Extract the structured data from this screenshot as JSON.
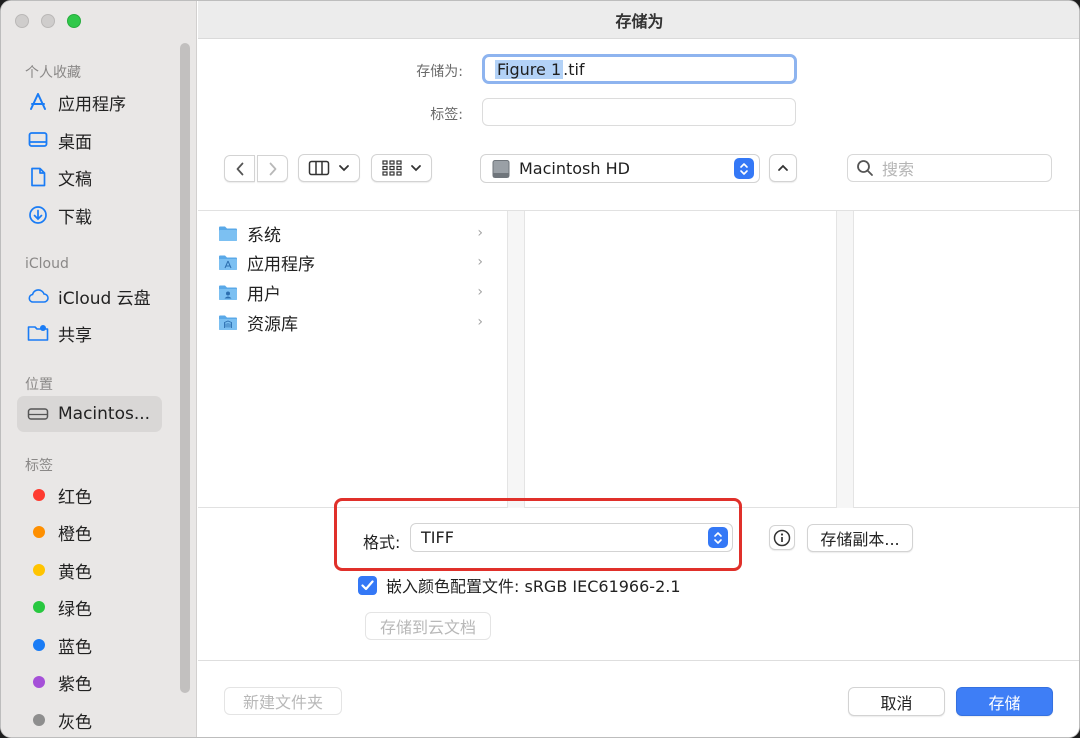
{
  "window": {
    "title": "存储为"
  },
  "sidebar": {
    "favorites_header": "个人收藏",
    "favorites": [
      {
        "label": "应用程序",
        "icon": "apps-icon"
      },
      {
        "label": "桌面",
        "icon": "desktop-icon"
      },
      {
        "label": "文稿",
        "icon": "document-icon"
      },
      {
        "label": "下载",
        "icon": "download-icon"
      }
    ],
    "icloud_header": "iCloud",
    "icloud": [
      {
        "label": "iCloud 云盘",
        "icon": "cloud-icon"
      },
      {
        "label": "共享",
        "icon": "shared-folder-icon"
      }
    ],
    "locations_header": "位置",
    "locations": [
      {
        "label": "Macintos...",
        "icon": "disk-icon",
        "selected": true
      }
    ],
    "tags_header": "标签",
    "tags": [
      {
        "label": "红色",
        "color": "#fe3b30"
      },
      {
        "label": "橙色",
        "color": "#fe8f00"
      },
      {
        "label": "黄色",
        "color": "#ffc400"
      },
      {
        "label": "绿色",
        "color": "#28c840"
      },
      {
        "label": "蓝色",
        "color": "#1a7cf5"
      },
      {
        "label": "紫色",
        "color": "#a550d8"
      },
      {
        "label": "灰色",
        "color": "#8e8e8e"
      }
    ]
  },
  "form": {
    "saveas_label": "存储为:",
    "filename_selected": "Figure 1",
    "filename_ext": ".tif",
    "tags_label": "标签:"
  },
  "toolbar": {
    "location": "Macintosh HD",
    "search_placeholder": "搜索"
  },
  "browser": {
    "items": [
      {
        "label": "系统"
      },
      {
        "label": "应用程序"
      },
      {
        "label": "用户"
      },
      {
        "label": "资源库"
      }
    ]
  },
  "options": {
    "format_label": "格式:",
    "format_value": "TIFF",
    "save_copy_label": "存储副本...",
    "embed_label": "嵌入颜色配置文件: sRGB IEC61966-2.1",
    "embed_checked": true,
    "save_to_cloud_label": "存储到云文档"
  },
  "footer": {
    "new_folder_label": "新建文件夹",
    "cancel_label": "取消",
    "save_label": "存储"
  }
}
